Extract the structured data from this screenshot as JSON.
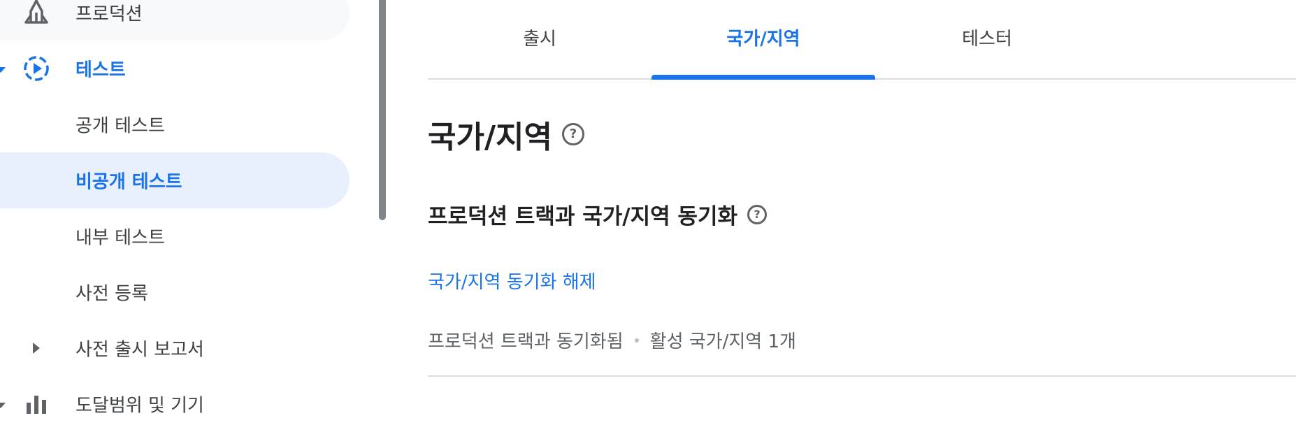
{
  "sidebar": {
    "items": [
      {
        "label": "프로덕션",
        "icon": "rocket-icon"
      },
      {
        "label": "테스트",
        "icon": "play-circle-icon"
      },
      {
        "label": "공개 테스트"
      },
      {
        "label": "비공개 테스트"
      },
      {
        "label": "내부 테스트"
      },
      {
        "label": "사전 등록"
      },
      {
        "label": "사전 출시 보고서"
      },
      {
        "label": "도달범위 및 기기"
      }
    ],
    "active_index": 3
  },
  "tabs": [
    {
      "label": "출시"
    },
    {
      "label": "국가/지역"
    },
    {
      "label": "테스터"
    }
  ],
  "active_tab": 1,
  "main": {
    "page_title": "국가/지역",
    "section_title": "프로덕션 트랙과 국가/지역 동기화",
    "unsync_link": "국가/지역 동기화 해제",
    "status_synced": "프로덕션 트랙과 동기화됨",
    "status_active": "활성 국가/지역 1개"
  },
  "icons": {
    "help": "help-circle-icon"
  },
  "colors": {
    "accent": "#1a73e8",
    "active_bg": "#e8f0fe",
    "text": "#202124",
    "muted": "#5f6368"
  }
}
